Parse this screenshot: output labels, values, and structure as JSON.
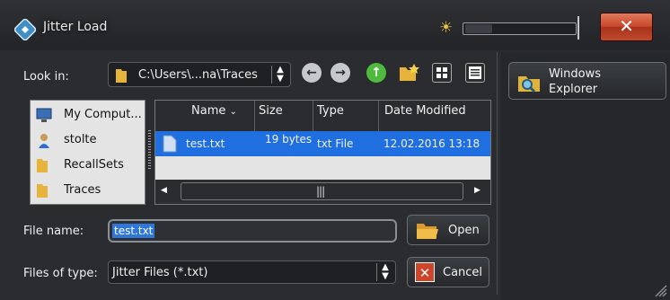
{
  "window": {
    "title": "Jitter Load"
  },
  "look_in": {
    "label": "Look in:",
    "path": "C:\\Users\\...na\\Traces",
    "icons": [
      "folder-icon",
      "back-icon",
      "forward-icon",
      "up-icon",
      "new-folder-icon",
      "icon-view-icon",
      "detail-view-icon"
    ]
  },
  "side": {
    "explorer_label": "Windows Explorer"
  },
  "places": [
    {
      "label": "My Comput...",
      "icon": "computer-icon"
    },
    {
      "label": "stolte",
      "icon": "user-icon"
    },
    {
      "label": "RecallSets",
      "icon": "folder-icon"
    },
    {
      "label": "Traces",
      "icon": "folder-icon"
    }
  ],
  "table": {
    "columns": [
      "Name",
      "Size",
      "Type",
      "Date Modified"
    ],
    "rows": [
      {
        "name": "test.txt",
        "size": "19 bytes",
        "type": "txt File",
        "date": "12.02.2016 13:18"
      }
    ]
  },
  "filename": {
    "label": "File name:",
    "value": "test.txt"
  },
  "filetype": {
    "label": "Files of type:",
    "value": "Jitter Files (*.txt)"
  },
  "buttons": {
    "open": "Open",
    "cancel": "Cancel"
  },
  "colors": {
    "accent": "#1f6fe0",
    "close": "#c8472b",
    "background": "#2a2c2f"
  }
}
